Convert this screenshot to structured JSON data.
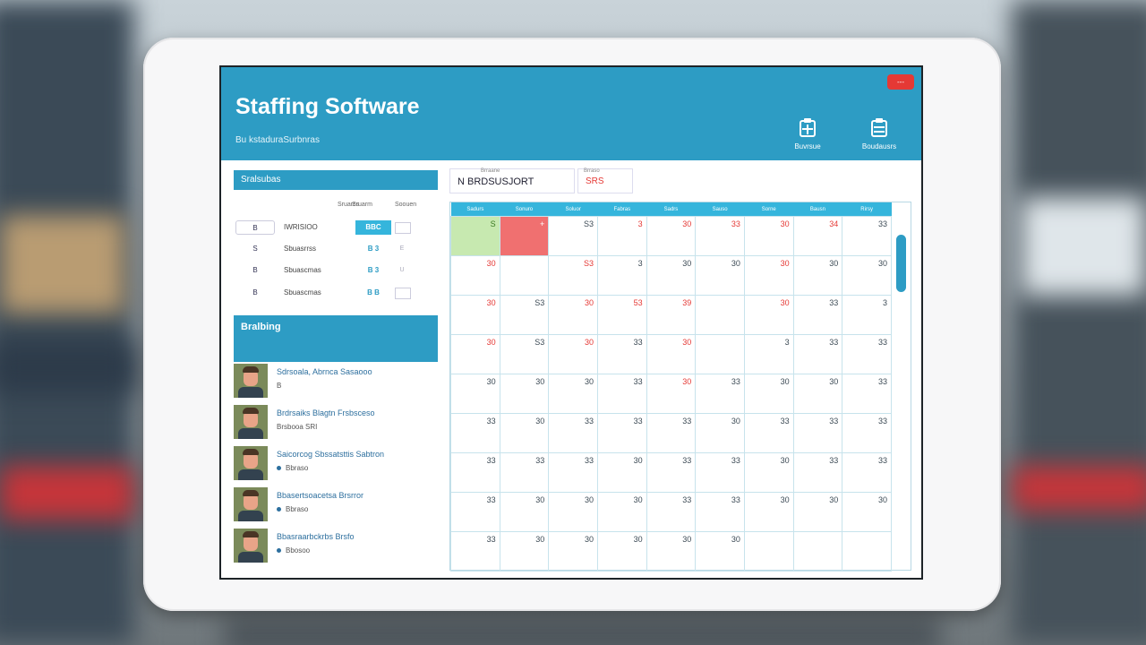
{
  "app": {
    "title": "Staffing Software",
    "subtitle": "Bu kstaduraSurbnras",
    "close_label": "---",
    "header_buttons": [
      {
        "label": "Buvrsue",
        "icon": "clipboard-icon"
      },
      {
        "label": "Boudausrs",
        "icon": "clipboard-icon"
      }
    ]
  },
  "shift_panel": {
    "title": "Sralsubas",
    "columns": [
      "Sruarcs",
      "Sruarm",
      "Soouen"
    ],
    "rows": [
      {
        "id": "B",
        "name": "IWRISIOO",
        "value": "BBC",
        "check": "",
        "selected": true
      },
      {
        "id": "S",
        "name": "Sbuasrrss",
        "value": "B 3",
        "check": "E",
        "selected": false
      },
      {
        "id": "B",
        "name": "Sbuascmas",
        "value": "B 3",
        "check": "U",
        "selected": false
      },
      {
        "id": "B",
        "name": "Sbuascmas",
        "value": "B B",
        "check": "",
        "selected": false
      }
    ]
  },
  "staff_panel": {
    "title": "Bralbing",
    "members": [
      {
        "name": "Sdrsoala, Abrnca Sasaooo",
        "detail": "B"
      },
      {
        "name": "Brdrsaiks Blagtn Frsbsceso",
        "detail": "Brsbooa   SRI"
      },
      {
        "name": "Saicorcog Sbssatsttis Sabtron",
        "detail": "Bbraso"
      },
      {
        "name": "Bbasertsoacetsa Brsrror",
        "detail": "Bbraso"
      },
      {
        "name": "Bbasraarbckrbs Brsfo",
        "detail": "Bbosoo"
      }
    ]
  },
  "toolbar": {
    "date_label": "Brraane",
    "date_value": "N BRDSUSJORT",
    "code_label": "Brraso",
    "code_value": "SRS"
  },
  "calendar": {
    "weekdays": [
      "Sadurs",
      "Sonuro",
      "Soluor",
      "Fabras",
      "Sadrs",
      "Sauso",
      "Sorne",
      "Bausn",
      "Rirsy"
    ],
    "rows": [
      [
        {
          "v": "S",
          "s": "hl-green"
        },
        {
          "v": "+",
          "s": "hl-red"
        },
        {
          "v": "S3",
          "s": ""
        },
        {
          "v": "3",
          "s": "red"
        },
        {
          "v": "30",
          "s": "red"
        },
        {
          "v": "33",
          "s": "red"
        },
        {
          "v": "30",
          "s": "red"
        },
        {
          "v": "34",
          "s": "red"
        },
        {
          "v": "33",
          "s": ""
        }
      ],
      [
        {
          "v": "30",
          "s": "red"
        },
        {
          "v": "",
          "s": ""
        },
        {
          "v": "S3",
          "s": "red"
        },
        {
          "v": "3",
          "s": ""
        },
        {
          "v": "30",
          "s": ""
        },
        {
          "v": "30",
          "s": ""
        },
        {
          "v": "30",
          "s": "red"
        },
        {
          "v": "30",
          "s": ""
        },
        {
          "v": "30",
          "s": ""
        }
      ],
      [
        {
          "v": "30",
          "s": "red"
        },
        {
          "v": "S3",
          "s": ""
        },
        {
          "v": "30",
          "s": "red"
        },
        {
          "v": "53",
          "s": "red"
        },
        {
          "v": "39",
          "s": "red"
        },
        {
          "v": "",
          "s": ""
        },
        {
          "v": "30",
          "s": "red"
        },
        {
          "v": "33",
          "s": ""
        },
        {
          "v": "3",
          "s": ""
        }
      ],
      [
        {
          "v": "30",
          "s": "red"
        },
        {
          "v": "S3",
          "s": ""
        },
        {
          "v": "30",
          "s": "red"
        },
        {
          "v": "33",
          "s": ""
        },
        {
          "v": "30",
          "s": "red"
        },
        {
          "v": "",
          "s": ""
        },
        {
          "v": "3",
          "s": ""
        },
        {
          "v": "33",
          "s": ""
        },
        {
          "v": "33",
          "s": ""
        }
      ],
      [
        {
          "v": "30",
          "s": ""
        },
        {
          "v": "30",
          "s": ""
        },
        {
          "v": "30",
          "s": ""
        },
        {
          "v": "33",
          "s": ""
        },
        {
          "v": "30",
          "s": "red"
        },
        {
          "v": "33",
          "s": ""
        },
        {
          "v": "30",
          "s": ""
        },
        {
          "v": "30",
          "s": ""
        },
        {
          "v": "33",
          "s": ""
        }
      ],
      [
        {
          "v": "33",
          "s": ""
        },
        {
          "v": "30",
          "s": ""
        },
        {
          "v": "33",
          "s": ""
        },
        {
          "v": "33",
          "s": ""
        },
        {
          "v": "33",
          "s": ""
        },
        {
          "v": "30",
          "s": ""
        },
        {
          "v": "33",
          "s": ""
        },
        {
          "v": "33",
          "s": ""
        },
        {
          "v": "33",
          "s": ""
        }
      ],
      [
        {
          "v": "33",
          "s": ""
        },
        {
          "v": "33",
          "s": ""
        },
        {
          "v": "33",
          "s": ""
        },
        {
          "v": "30",
          "s": ""
        },
        {
          "v": "33",
          "s": ""
        },
        {
          "v": "33",
          "s": ""
        },
        {
          "v": "30",
          "s": ""
        },
        {
          "v": "33",
          "s": ""
        },
        {
          "v": "33",
          "s": ""
        }
      ],
      [
        {
          "v": "33",
          "s": ""
        },
        {
          "v": "30",
          "s": ""
        },
        {
          "v": "30",
          "s": ""
        },
        {
          "v": "30",
          "s": ""
        },
        {
          "v": "33",
          "s": ""
        },
        {
          "v": "33",
          "s": ""
        },
        {
          "v": "30",
          "s": ""
        },
        {
          "v": "30",
          "s": ""
        },
        {
          "v": "30",
          "s": ""
        }
      ],
      [
        {
          "v": "33",
          "s": ""
        },
        {
          "v": "30",
          "s": ""
        },
        {
          "v": "30",
          "s": ""
        },
        {
          "v": "30",
          "s": ""
        },
        {
          "v": "30",
          "s": ""
        },
        {
          "v": "30",
          "s": ""
        },
        {
          "v": "",
          "s": ""
        },
        {
          "v": "",
          "s": ""
        },
        {
          "v": "",
          "s": ""
        }
      ]
    ]
  },
  "colors": {
    "accent": "#2d9cc4",
    "highlight_green": "#c7e9b0",
    "highlight_red": "#f07070",
    "alert": "#e53935"
  }
}
